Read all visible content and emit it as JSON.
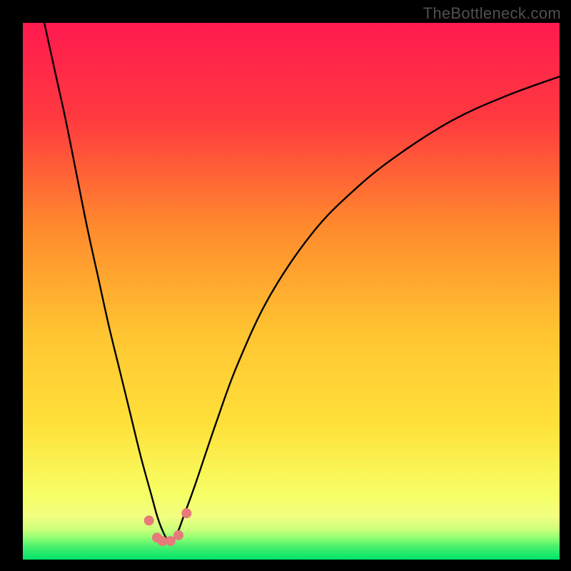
{
  "watermark": "TheBottleneck.com",
  "chart_data": {
    "type": "line",
    "title": "",
    "xlabel": "",
    "ylabel": "",
    "xlim": [
      0,
      100
    ],
    "ylim": [
      0,
      110
    ],
    "grid": false,
    "background_gradient": {
      "top": "#ff1a4f",
      "mid_upper": "#ff8a2d",
      "mid": "#ffe13a",
      "mid_lower": "#f6ff66",
      "narrow_band": "#9bff7a",
      "bottom": "#00e36b"
    },
    "series": [
      {
        "name": "bottleneck-curve",
        "color": "#000000",
        "x": [
          4,
          6,
          8,
          10,
          12,
          14,
          16,
          18,
          20,
          22,
          24,
          25,
          26,
          27,
          28,
          29,
          30,
          32,
          36,
          40,
          46,
          54,
          62,
          70,
          80,
          90,
          100
        ],
        "y": [
          110,
          100,
          90,
          79,
          68,
          58,
          48,
          39,
          30,
          21,
          13,
          9,
          6,
          4,
          4,
          6,
          9,
          15,
          28,
          40,
          54,
          67,
          76,
          83,
          90,
          95,
          99
        ]
      },
      {
        "name": "markers",
        "type": "scatter",
        "color": "#e77a7a",
        "x": [
          23.5,
          25.0,
          26.0,
          27.5,
          29.0,
          30.5
        ],
        "y": [
          8.0,
          4.5,
          3.8,
          3.8,
          5.0,
          9.5
        ]
      }
    ]
  }
}
